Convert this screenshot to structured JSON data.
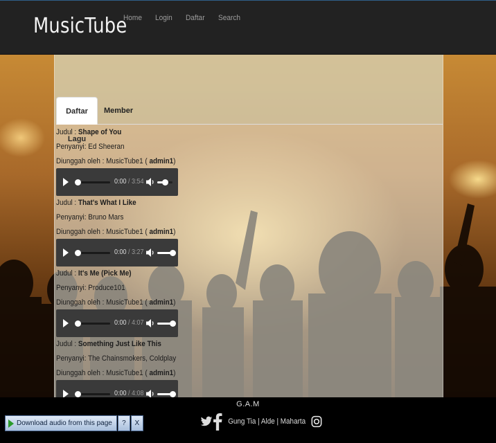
{
  "header": {
    "logo": "MusicTube",
    "nav": [
      "Home",
      "Login",
      "Daftar",
      "Search"
    ]
  },
  "tabs": [
    {
      "label": "Daftar Lagu",
      "active": true
    },
    {
      "label": "Member",
      "active": false
    }
  ],
  "labels": {
    "judul": "Judul : ",
    "penyanyi": "Penyanyi: ",
    "diunggah": "Diunggah oleh : ",
    "open_paren": " ( ",
    "close_paren": ")"
  },
  "songs": [
    {
      "title": "Shape of You",
      "artist": "Ed Sheeran",
      "uploader": "MusicTube1",
      "uploader_id": "admin1",
      "current": "0:00",
      "duration": "/ 3:54",
      "volume": 0.5
    },
    {
      "title": "That's What I Like",
      "artist": "Bruno Mars",
      "uploader": "MusicTube1",
      "uploader_id": "admin1",
      "current": "0:00",
      "duration": "/ 3:27",
      "volume": 1
    },
    {
      "title": "It's Me (Pick Me)",
      "artist": "Produce101",
      "uploader": "MusicTube1",
      "uploader_id": "admin1",
      "current": "0:00",
      "duration": "/ 4:07",
      "volume": 1
    },
    {
      "title": "Something Just Like This",
      "artist": "The Chainsmokers, Coldplay",
      "uploader": "MusicTube1",
      "uploader_id": "admin1",
      "current": "0:00",
      "duration": "/ 4:08",
      "volume": 1
    }
  ],
  "footer": {
    "title": "G.A.M",
    "credits": "Gung Tia | Alde | Maharta"
  },
  "download_bar": {
    "label": "Download audio from this page",
    "help": "?",
    "close": "X"
  },
  "colors": {
    "header_bg": "#222222",
    "nav_text": "#9d9d9d",
    "player_bg": "#3a3a3a",
    "footer_bg": "#000000"
  },
  "icons": [
    "play-icon",
    "volume-icon",
    "twitter-icon",
    "facebook-icon",
    "instagram-icon",
    "download-arrow-icon"
  ]
}
